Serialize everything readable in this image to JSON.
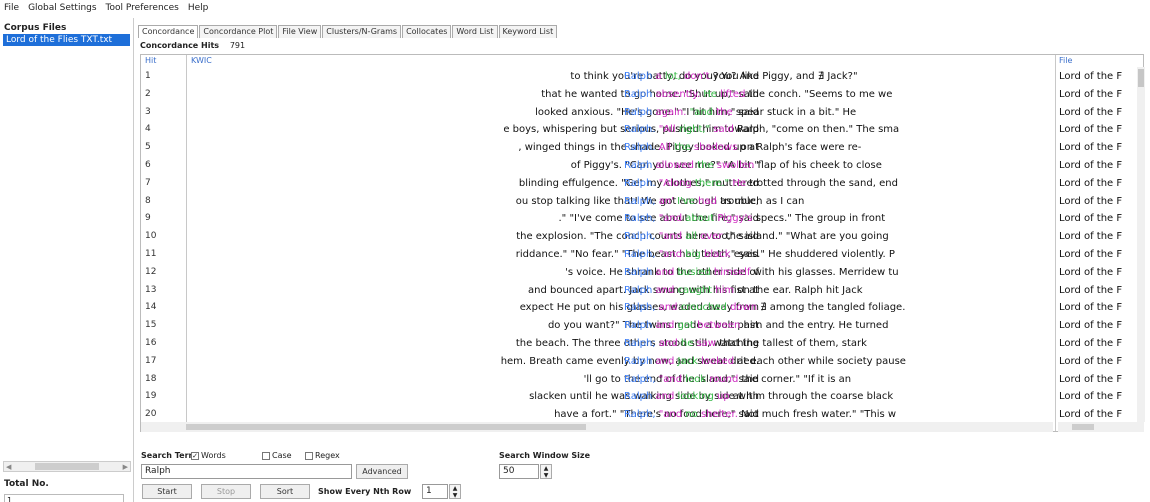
{
  "menu": [
    "File",
    "Global Settings",
    "Tool Preferences",
    "Help"
  ],
  "corpus": {
    "title": "Corpus Files",
    "files": [
      "Lord of the Flies TXT.txt"
    ],
    "total_label": "Total No.",
    "total_value": "1"
  },
  "tabs": [
    "Concordance",
    "Concordance Plot",
    "File View",
    "Clusters/N-Grams",
    "Collocates",
    "Word List",
    "Keyword List"
  ],
  "hits": {
    "label": "Concordance Hits",
    "value": "791"
  },
  "columns": {
    "hit": "Hit",
    "kwic": "KWIC",
    "file": "File"
  },
  "rows": [
    {
      "n": "1",
      "left": "to think you're batty, do you? You like",
      "kw": "Ralph",
      "c1": "a",
      "c2": "lot,",
      "c3": "don't",
      "rest": "you? And Piggy, and ∄ Jack?\"",
      "file": "Lord of the F"
    },
    {
      "n": "2",
      "left": "that he wanted to go home.  \"Shut up,\" said",
      "kw": "Ralph",
      "c1": "absently.",
      "c2": "He",
      "c3": "lifted",
      "rest": "the conch. \"Seems to me we",
      "file": "Lord of the F"
    },
    {
      "n": "3",
      "left": "looked anxious.  \"He's gone.\"  \"I hit him,\" said",
      "kw": "Ralph",
      "c1": "again.",
      "c2": "\"and",
      "c3": "the",
      "rest": "spear stuck in a bit.\"  He",
      "file": "Lord of the F"
    },
    {
      "n": "4",
      "left": "e boys, whispering but serious, pushed him toward",
      "kw": "Ralph.",
      "c1": "\"All",
      "c2": "right,\"",
      "c3": "said",
      "rest": "Ralph, \"come on then.\" The sma",
      "file": "Lord of the F"
    },
    {
      "n": "5",
      "left": ", winged things in the shade.  Piggy looked up at",
      "kw": "Ralph.",
      "c1": "All",
      "c2": "the",
      "c3": "shadows",
      "rest": "on Ralph's face were re-",
      "file": "Lord of the F"
    },
    {
      "n": "6",
      "left": "of Piggy's.  \"Can you see me?\"  \"A bit.\"",
      "kw": "Ralph",
      "c1": "allowed",
      "c2": "the",
      "c3": "swollen",
      "rest": "flap of his cheek to close",
      "file": "Lord of the F"
    },
    {
      "n": "7",
      "left": "blinding effulgence.  \"Get my clothes,\" muttered",
      "kw": "Ralph.",
      "c1": "\"Along",
      "c2": "there.\"",
      "c3": "He",
      "rest": "trotted through the sand, end",
      "file": "Lord of the F"
    },
    {
      "n": "8",
      "left": "ou stop talking like that! We got enough trouble,",
      "kw": "Ralph,",
      "c1": "an'",
      "c2": "I've",
      "c3": "had",
      "rest": "as much as I can",
      "file": "Lord of the F"
    },
    {
      "n": "9",
      "left": ".\"  \"I've come to see about the fire,\" said",
      "kw": "Ralph,",
      "c1": "\"and",
      "c2": "about",
      "c3": "Piggy's",
      "rest": "specs.\" The group in front",
      "file": "Lord of the F"
    },
    {
      "n": "10",
      "left": "the explosion.  \"The conch counts here too,\" said",
      "kw": "Ralph,",
      "c1": "\"and",
      "c2": "all",
      "c3": "over",
      "rest": "the island.\" \"What are you going",
      "file": "Lord of the F"
    },
    {
      "n": "11",
      "left": "riddance.\"  \"No fear.\"  \"The beast had teeth,\" said",
      "kw": "Ralph,",
      "c1": "\"and",
      "c2": "big",
      "c3": "black",
      "rest": "eyes.\"  He shuddered violently. P",
      "file": "Lord of the F"
    },
    {
      "n": "12",
      "left": "'s voice. He shrank to the other side of",
      "kw": "Ralph",
      "c1": "and",
      "c2": "busied",
      "c3": "himself",
      "rest": "with his glasses.  Merridew tu",
      "file": "Lord of the F"
    },
    {
      "n": "13",
      "left": "and bounced apart. Jack swung with his fist at",
      "kw": "Ralph",
      "c1": "and",
      "c2": "caught",
      "c3": "him",
      "rest": "on the ear. Ralph hit Jack",
      "file": "Lord of the F"
    },
    {
      "n": "14",
      "left": "expect  He put on his glasses, waded away from",
      "kw": "Ralph,",
      "c1": "and",
      "c2": "crouched",
      "c3": "down",
      "rest": "∄  among the tangled foliage.",
      "file": "Lord of the F"
    },
    {
      "n": "15",
      "left": "do you want?\"  The twins made a bolt past",
      "kw": "Ralph",
      "c1": "and",
      "c2": "got",
      "c3": "between",
      "rest": "him and the entry. He turned",
      "file": "Lord of the F"
    },
    {
      "n": "16",
      "left": "the beach. The three others stood still, watching",
      "kw": "Ralph;",
      "c1": "and",
      "c2": "he",
      "c3": "saw",
      "rest": "that the tallest of them, stark",
      "file": "Lord of the F"
    },
    {
      "n": "17",
      "left": "hem. Breath came evenly by now, and sweat dried.",
      "kw": "Ralph",
      "c1": "and",
      "c2": "Jack",
      "c3": "looked",
      "rest": "at each other while society pause",
      "file": "Lord of the F"
    },
    {
      "n": "18",
      "left": "'ll go to the end of the island,\" said",
      "kw": "Ralph,",
      "c1": "\"and",
      "c2": "look",
      "c3": "round",
      "rest": "the corner.\"  \"If it is an",
      "file": "Lord of the F"
    },
    {
      "n": "19",
      "left": "slacken until he was walking side by side with",
      "kw": "Ralph",
      "c1": "and",
      "c2": "looking",
      "c3": "up",
      "rest": "at him through the coarse black",
      "file": "Lord of the F"
    },
    {
      "n": "20",
      "left": "have a fort.\"  \"There's no food here,\" said",
      "kw": "Ralph,",
      "c1": "\"and",
      "c2": "no",
      "c3": "shelter.",
      "rest": "Not much fresh water.\"  \"This w",
      "file": "Lord of the F"
    }
  ],
  "search": {
    "term_label": "Search Term",
    "words_label": "Words",
    "case_label": "Case",
    "regex_label": "Regex",
    "value": "Ralph",
    "advanced_label": "Advanced",
    "window_label": "Search Window Size",
    "window_value": "50",
    "start_label": "Start",
    "stop_label": "Stop",
    "sort_label": "Sort",
    "nth_label": "Show Every Nth Row",
    "nth_value": "1"
  }
}
